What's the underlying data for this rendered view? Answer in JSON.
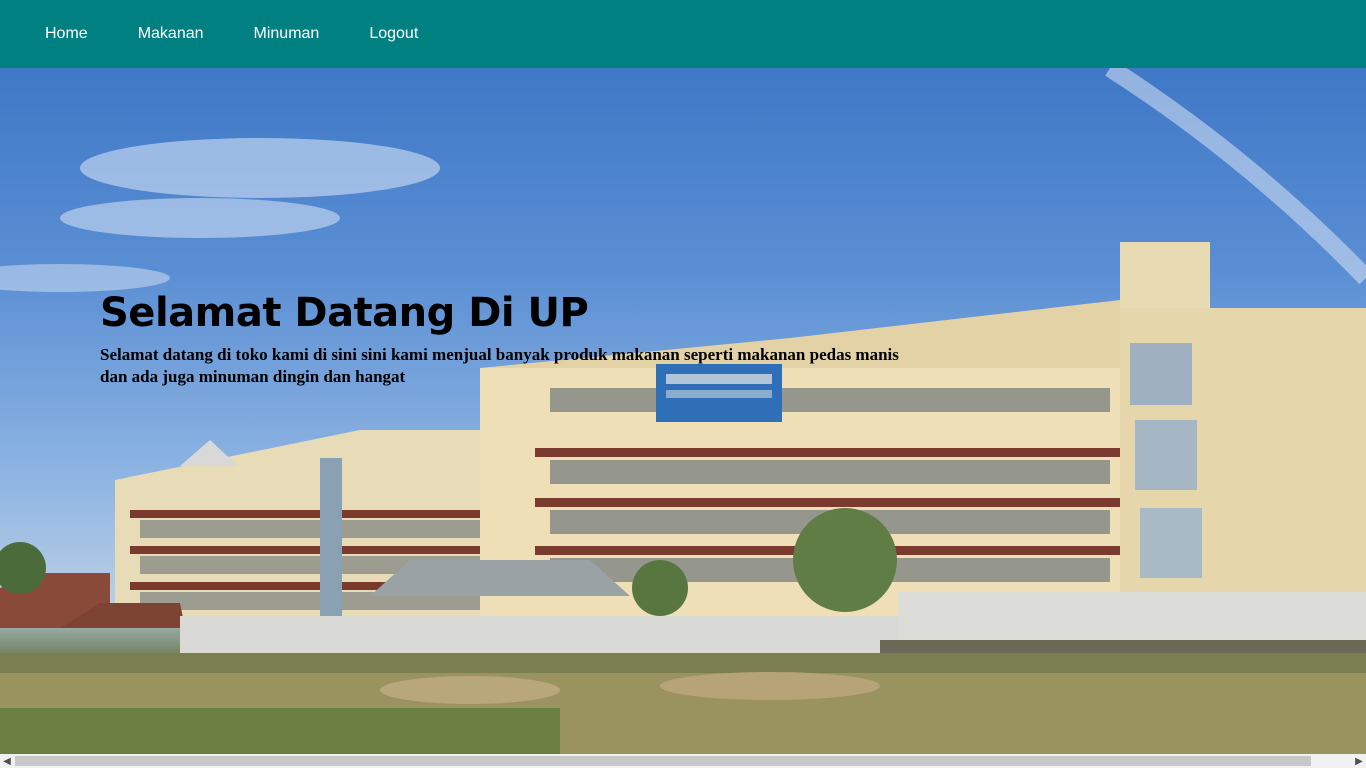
{
  "nav": {
    "items": [
      {
        "label": "Home"
      },
      {
        "label": "Makanan"
      },
      {
        "label": "Minuman"
      },
      {
        "label": "Logout"
      }
    ],
    "background_color": "#008080"
  },
  "hero": {
    "title": "Selamat Datang Di UP",
    "description": "Selamat datang di toko kami di sini sini kami menjual banyak produk makanan seperti makanan pedas manis dan ada juga minuman dingin dan hangat",
    "background_image": "school-building-photo"
  },
  "scrollbar": {
    "left_icon": "chevron-left-icon",
    "right_icon": "chevron-right-icon"
  }
}
